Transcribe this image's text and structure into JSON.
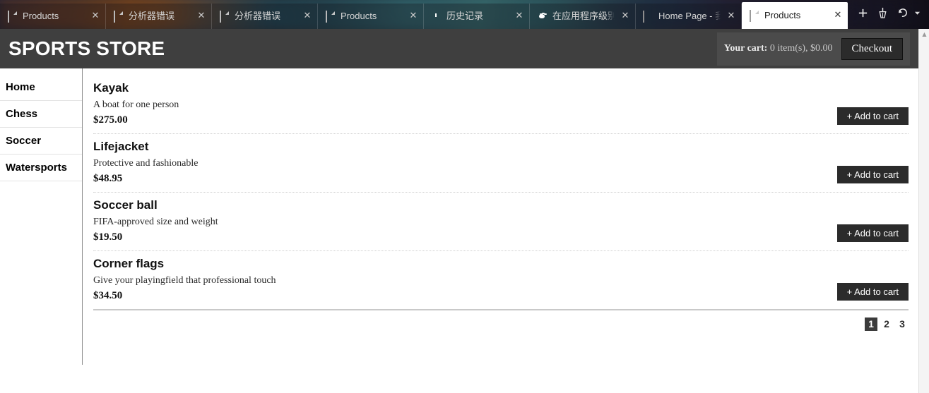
{
  "browser": {
    "tabs": [
      {
        "title": "Products",
        "icon": "document-icon",
        "active": false
      },
      {
        "title": "分析器错误",
        "icon": "document-icon",
        "active": false
      },
      {
        "title": "分析器错误",
        "icon": "document-icon",
        "active": false
      },
      {
        "title": "Products",
        "icon": "document-icon",
        "active": false
      },
      {
        "title": "历史记录",
        "icon": "clock-icon",
        "active": false
      },
      {
        "title": "在应用程序级别之",
        "icon": "paw-icon",
        "active": false
      },
      {
        "title": "Home Page - 我",
        "icon": "book-icon",
        "active": false
      },
      {
        "title": "Products",
        "icon": "document-icon",
        "active": true
      }
    ],
    "close_label": "✕",
    "actions": {
      "new_tab": "+",
      "new_tab_name": "new-tab-button",
      "cleaner": "broom-icon",
      "history_back": "undo-icon",
      "history_caret": "▾"
    }
  },
  "header": {
    "brand": "SPORTS STORE",
    "cart_label": "Your cart:",
    "cart_summary": "0 item(s), $0.00",
    "checkout_label": "Checkout",
    "bg_color": "#3f3f3f",
    "cart_bg_color": "#4b4b4b"
  },
  "sidebar": {
    "items": [
      {
        "label": "Home"
      },
      {
        "label": "Chess"
      },
      {
        "label": "Soccer"
      },
      {
        "label": "Watersports"
      }
    ]
  },
  "products": [
    {
      "name": "Kayak",
      "description": "A boat for one person",
      "price": "$275.00",
      "button": "+ Add to cart"
    },
    {
      "name": "Lifejacket",
      "description": "Protective and fashionable",
      "price": "$48.95",
      "button": "+ Add to cart"
    },
    {
      "name": "Soccer ball",
      "description": "FIFA-approved size and weight",
      "price": "$19.50",
      "button": "+ Add to cart"
    },
    {
      "name": "Corner flags",
      "description": "Give your playingfield that professional touch",
      "price": "$34.50",
      "button": "+ Add to cart"
    }
  ],
  "pagination": {
    "pages": [
      {
        "label": "1",
        "current": true
      },
      {
        "label": "2",
        "current": false
      },
      {
        "label": "3",
        "current": false
      }
    ],
    "current_bg": "#3b3b3b"
  },
  "scrollbar": {
    "up_arrow": "▲",
    "down_arrow": "▼"
  }
}
